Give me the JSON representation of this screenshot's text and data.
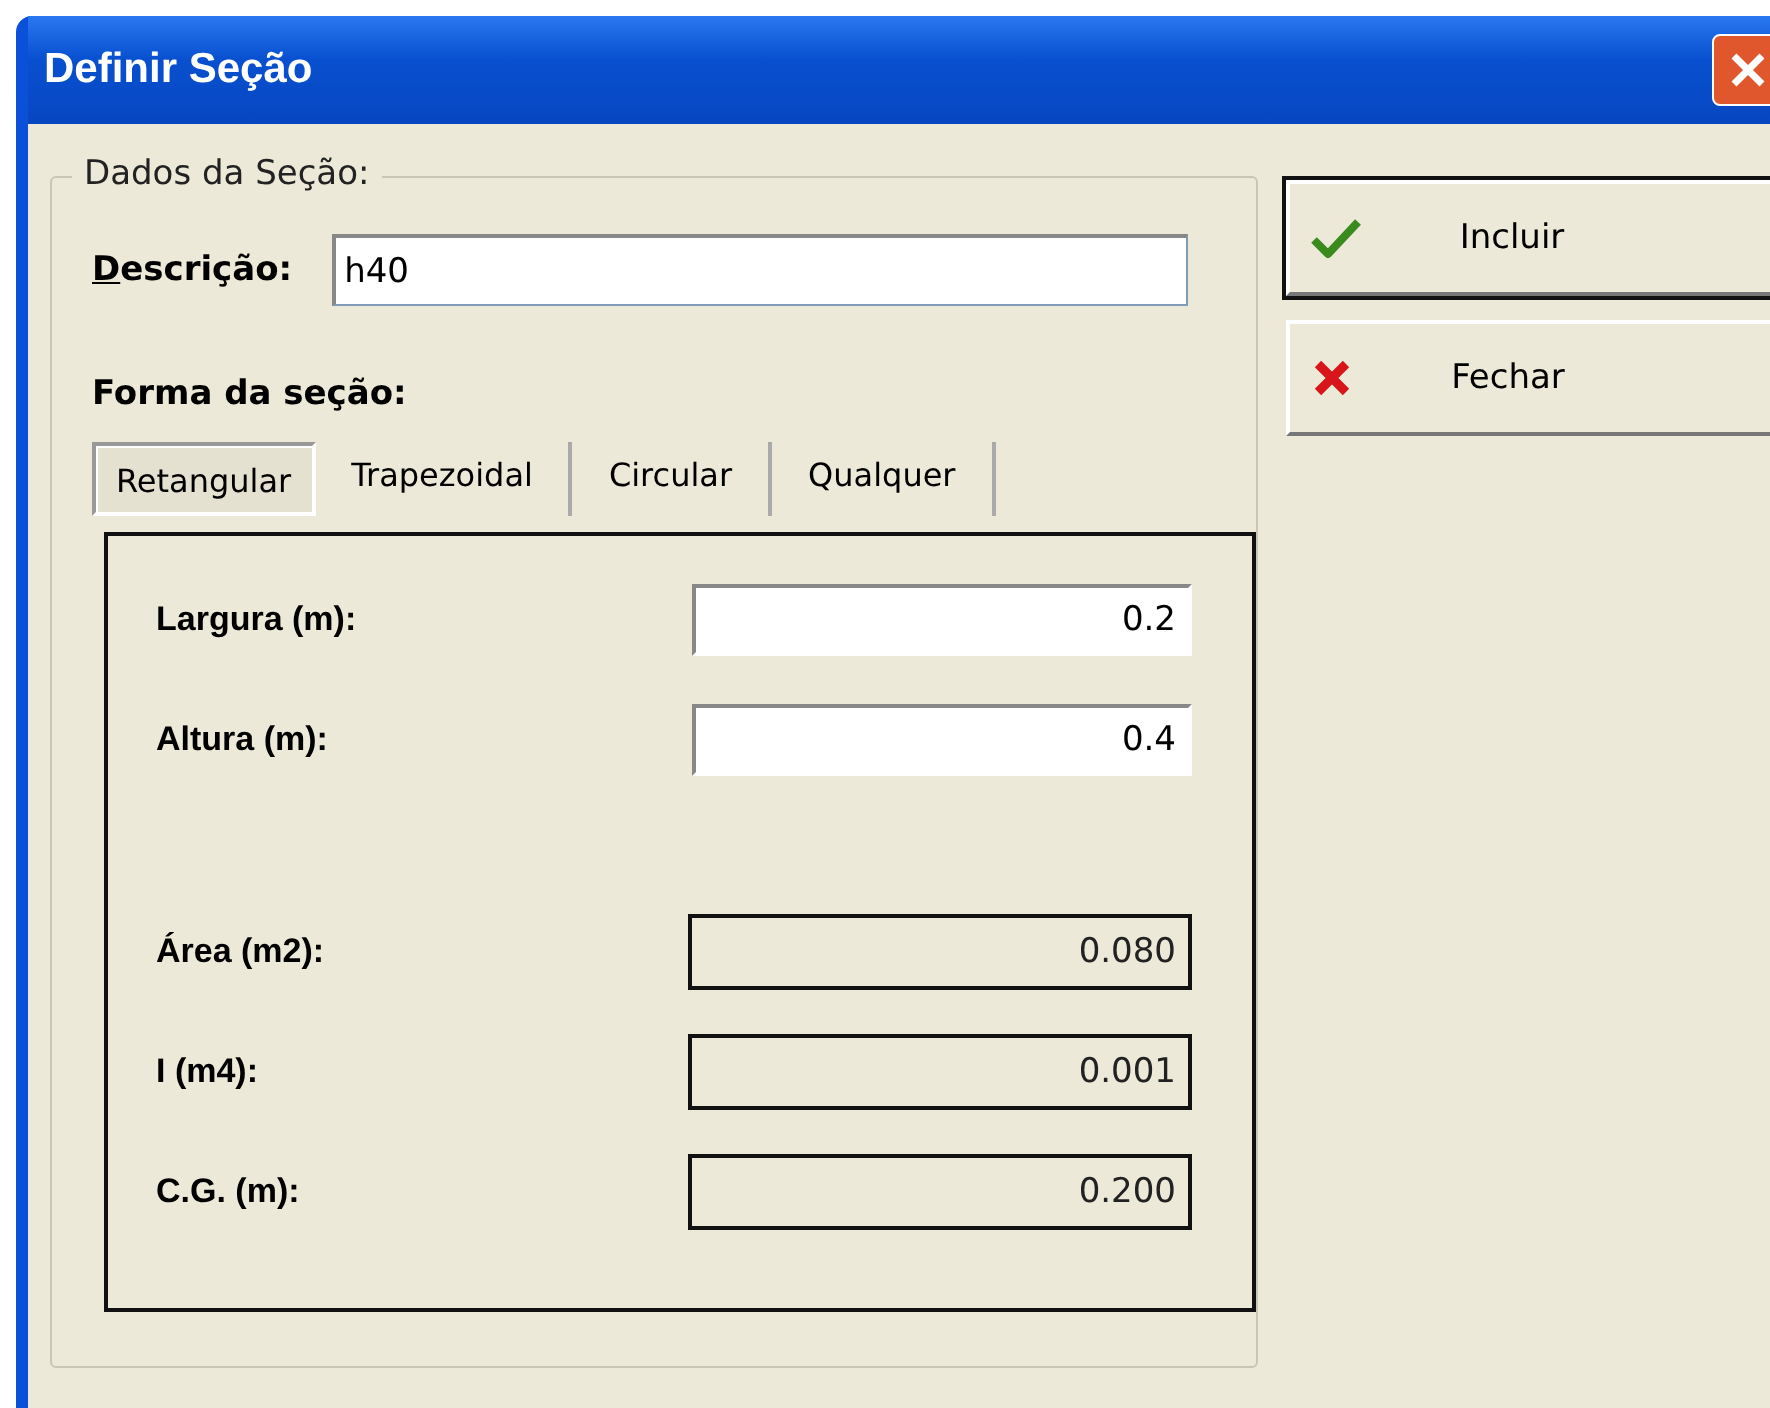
{
  "window": {
    "title": "Definir Seção"
  },
  "group": {
    "legend": "Dados da Seção:"
  },
  "description": {
    "label": "Descrição:",
    "value": "h40"
  },
  "shape_label": "Forma da seção:",
  "tabs": [
    {
      "label": "Retangular",
      "selected": true
    },
    {
      "label": "Trapezoidal",
      "selected": false
    },
    {
      "label": "Circular",
      "selected": false
    },
    {
      "label": "Qualquer",
      "selected": false
    }
  ],
  "fields": [
    {
      "label": "Largura (m):",
      "value": "0.2",
      "kind": "input"
    },
    {
      "label": "Altura (m):",
      "value": "0.4",
      "kind": "input"
    },
    {
      "label": "Área (m2):",
      "value": "0.080",
      "kind": "readonly"
    },
    {
      "label": "I (m4):",
      "value": "0.001",
      "kind": "readonly"
    },
    {
      "label": "C.G. (m):",
      "value": "0.200",
      "kind": "readonly"
    }
  ],
  "buttons": [
    {
      "label": "Incluir",
      "kind": "confirm"
    },
    {
      "label": "Fechar",
      "kind": "close"
    }
  ]
}
